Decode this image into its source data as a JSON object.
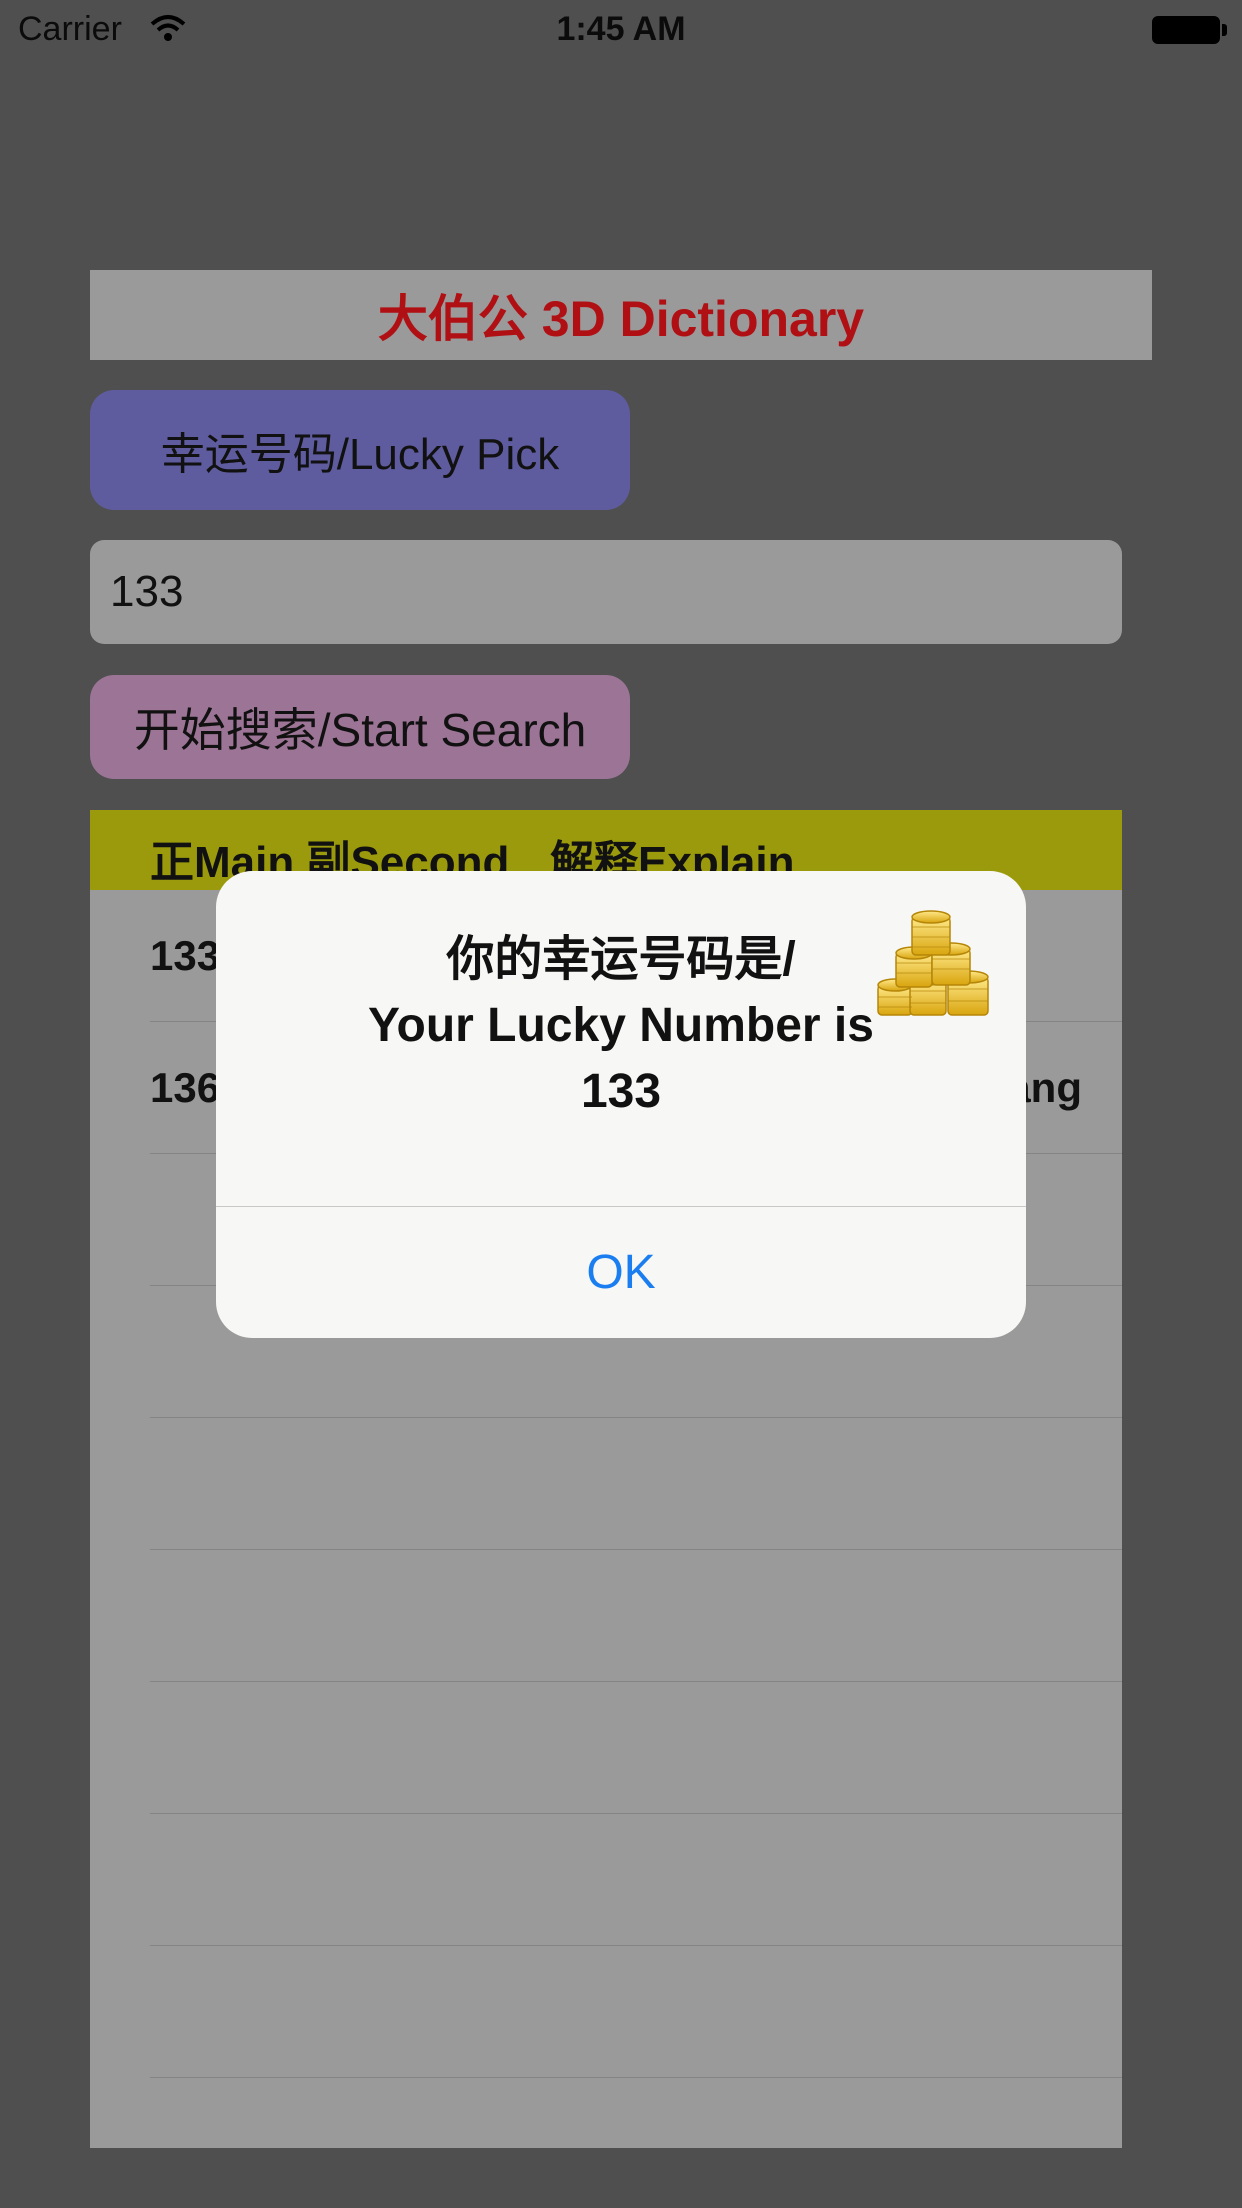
{
  "status_bar": {
    "carrier": "Carrier",
    "time": "1:45 AM"
  },
  "header": {
    "title": "大伯公 3D Dictionary"
  },
  "lucky_button": {
    "label": "幸运号码/Lucky Pick"
  },
  "number_input": {
    "value": "133"
  },
  "search_button": {
    "label": "开始搜索/Start Search"
  },
  "table": {
    "headers": {
      "main_second": "正Main 副Second",
      "explain": "解释Explain"
    },
    "rows": [
      {
        "num": "133",
        "tail": ""
      },
      {
        "num": "136",
        "tail": "ang"
      }
    ]
  },
  "alert": {
    "line1": "你的幸运号码是/",
    "line2": "Your Lucky Number is",
    "number": "133",
    "ok_label": "OK",
    "icon": "gold-coins-icon"
  },
  "colors": {
    "title_red": "#b01014",
    "lucky_button": "#5e5c9e",
    "search_button": "#9c7496",
    "table_header": "#9a9a0c",
    "ok_blue": "#1b7ef0"
  }
}
